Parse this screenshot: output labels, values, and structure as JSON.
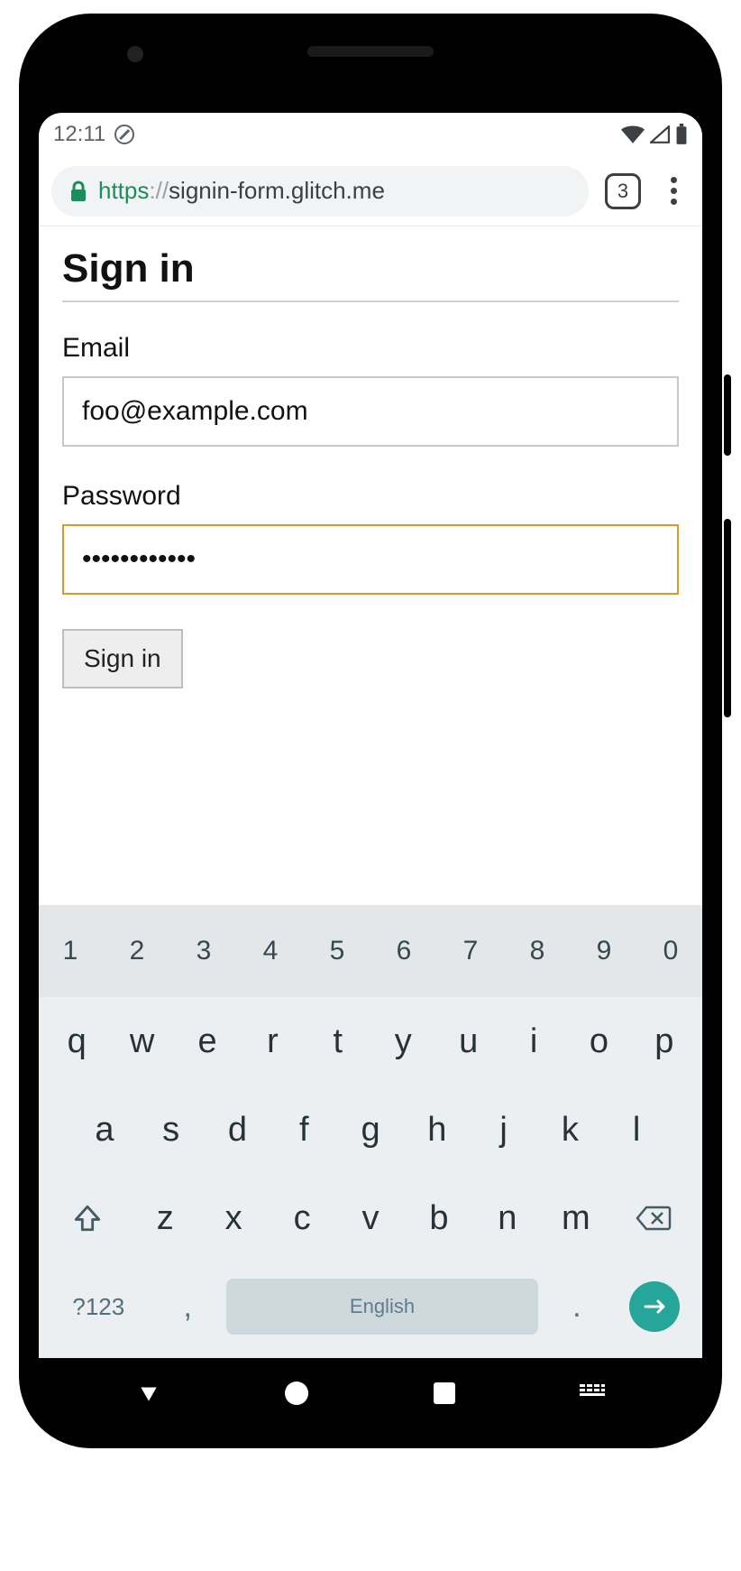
{
  "status_bar": {
    "time": "12:11"
  },
  "browser": {
    "url_scheme": "https",
    "url_sep": "://",
    "url_host": "signin-form.glitch.me",
    "tab_count": "3"
  },
  "page": {
    "title": "Sign in",
    "email_label": "Email",
    "email_value": "foo@example.com",
    "password_label": "Password",
    "password_value": "••••••••••••",
    "submit_label": "Sign in"
  },
  "keyboard": {
    "row_num": [
      "1",
      "2",
      "3",
      "4",
      "5",
      "6",
      "7",
      "8",
      "9",
      "0"
    ],
    "row2": [
      "q",
      "w",
      "e",
      "r",
      "t",
      "y",
      "u",
      "i",
      "o",
      "p"
    ],
    "row3": [
      "a",
      "s",
      "d",
      "f",
      "g",
      "h",
      "j",
      "k",
      "l"
    ],
    "row4": [
      "z",
      "x",
      "c",
      "v",
      "b",
      "n",
      "m"
    ],
    "symbols_label": "?123",
    "comma": ",",
    "space_label": "English",
    "dot": "."
  }
}
